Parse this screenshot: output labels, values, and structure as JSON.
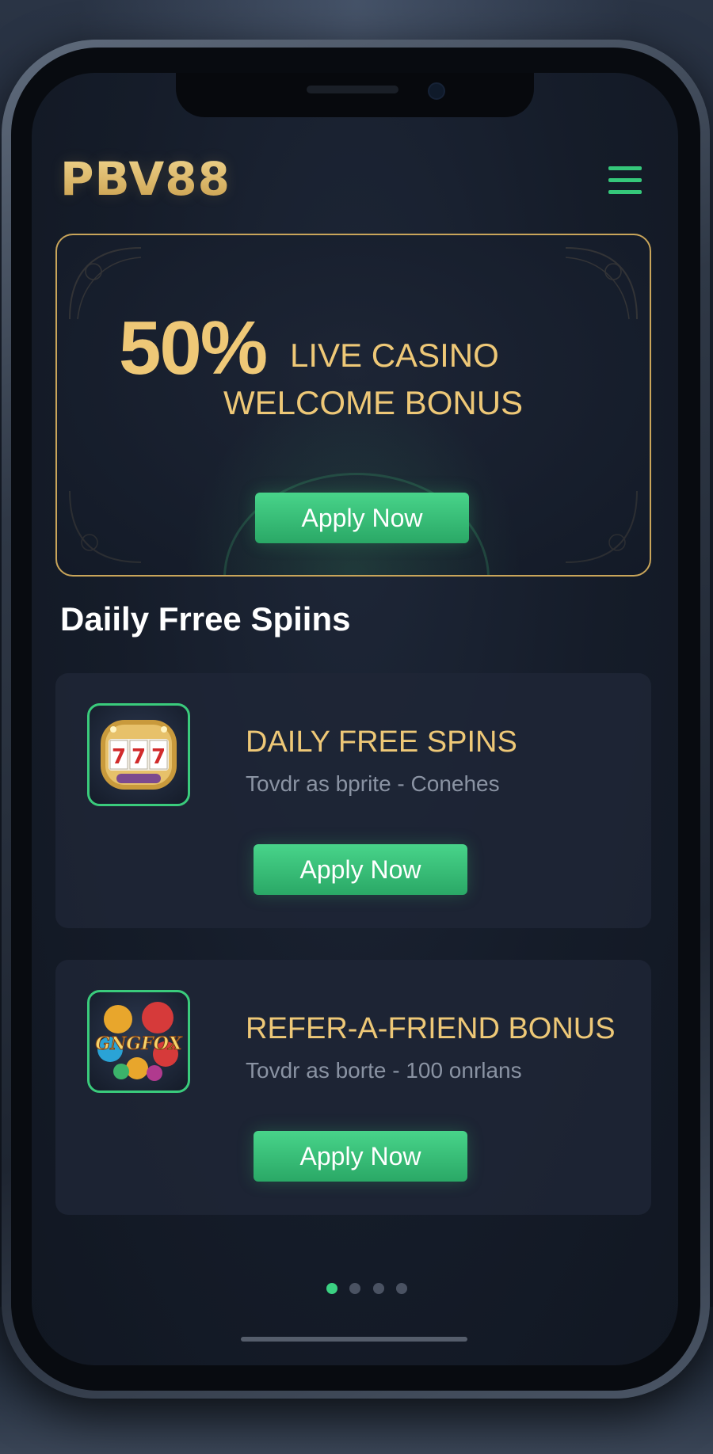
{
  "header": {
    "logo_text": "PBV88",
    "menu_icon": "hamburger-menu-icon"
  },
  "banner": {
    "percent": "50%",
    "line1": "LIVE CASINO",
    "line2": "WELCOME BONUS",
    "button_label": "Apply Now"
  },
  "section": {
    "title": "Daiily Frree Spiins"
  },
  "cards": [
    {
      "title": "DAILY FREE SPINS",
      "subtitle": "Tovdr as bprite - Conehes",
      "button_label": "Apply Now",
      "icon": "slot-machine-777-icon",
      "icon_text": "777"
    },
    {
      "title": "REFER-A-FRIEND BONUS",
      "subtitle": "Tovdr as borte - 100 onrlans",
      "button_label": "Apply Now",
      "icon": "casino-chips-icon",
      "icon_text": "GNGFOX"
    }
  ],
  "pagination": {
    "total": 4,
    "active": 1
  },
  "colors": {
    "accent_green": "#3bd182",
    "gold": "#eec877",
    "background": "#151c29"
  }
}
